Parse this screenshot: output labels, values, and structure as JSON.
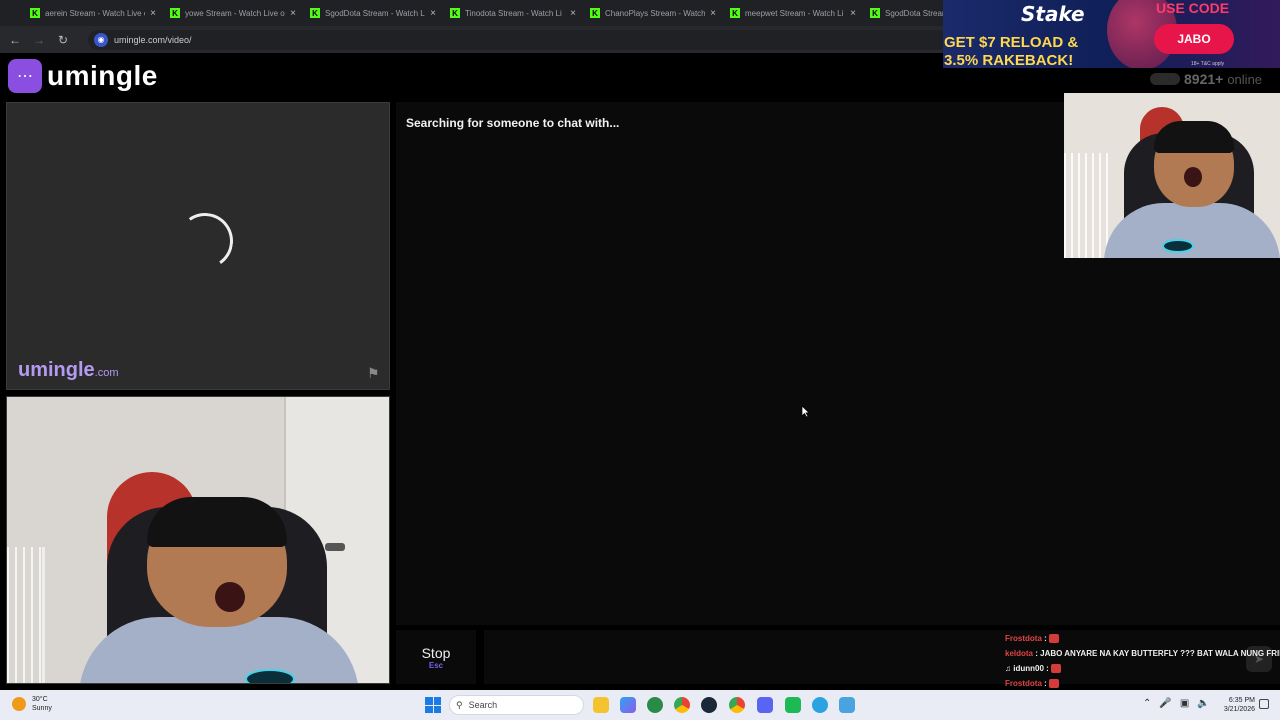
{
  "browser": {
    "tabs": [
      {
        "title": "aerein Stream - Watch Live o"
      },
      {
        "title": "yowe Stream - Watch Live on"
      },
      {
        "title": "SgodDota Stream - Watch Li"
      },
      {
        "title": "Tinodota Stream - Watch Li"
      },
      {
        "title": "ChanoPlays Stream - Watch"
      },
      {
        "title": "meepwet Stream - Watch Li"
      },
      {
        "title": "SgodDota Stream"
      }
    ],
    "tab_favicon_letter": "K",
    "tab_close_glyph": "×",
    "url": "umingle.com/video/",
    "nav": {
      "back_icon": "arrow-left-icon",
      "forward_icon": "arrow-right-icon",
      "reload_icon": "reload-icon"
    }
  },
  "ad": {
    "brand": "Stake",
    "offer_line1": "GET $7 RELOAD &",
    "offer_line2": "3.5% RAKEBACK!",
    "use_code_label": "USE CODE",
    "code": "JABO",
    "terms": "18+ T&C apply"
  },
  "app": {
    "logo_text": "umingle",
    "online_count": "8921+",
    "online_label": "online"
  },
  "stranger_panel": {
    "watermark": "umingle",
    "watermark_domain": ".com",
    "report_icon": "flag-icon"
  },
  "chat": {
    "status": "Searching for someone to chat with...",
    "stop_label": "Stop",
    "stop_key": "Esc"
  },
  "stream_chat": [
    {
      "user": "Frostdota",
      "text": ""
    },
    {
      "user": "keldota",
      "text": "JABO ANYARE NA KAY BUTTERFLY ??? BAT WALA NUNG FRIDAY"
    },
    {
      "user": "idunn00",
      "text": ""
    },
    {
      "user": "Frostdota",
      "text": ""
    }
  ],
  "taskbar": {
    "weather_temp": "30°C",
    "weather_desc": "Sunny",
    "search_placeholder": "Search",
    "time": "6:35 PM",
    "date": "3/21/2026"
  },
  "colors": {
    "brand_purple": "#8a4fe0",
    "kick_green": "#53fc18",
    "stake_pink": "#e8154b",
    "background": "#000000"
  }
}
